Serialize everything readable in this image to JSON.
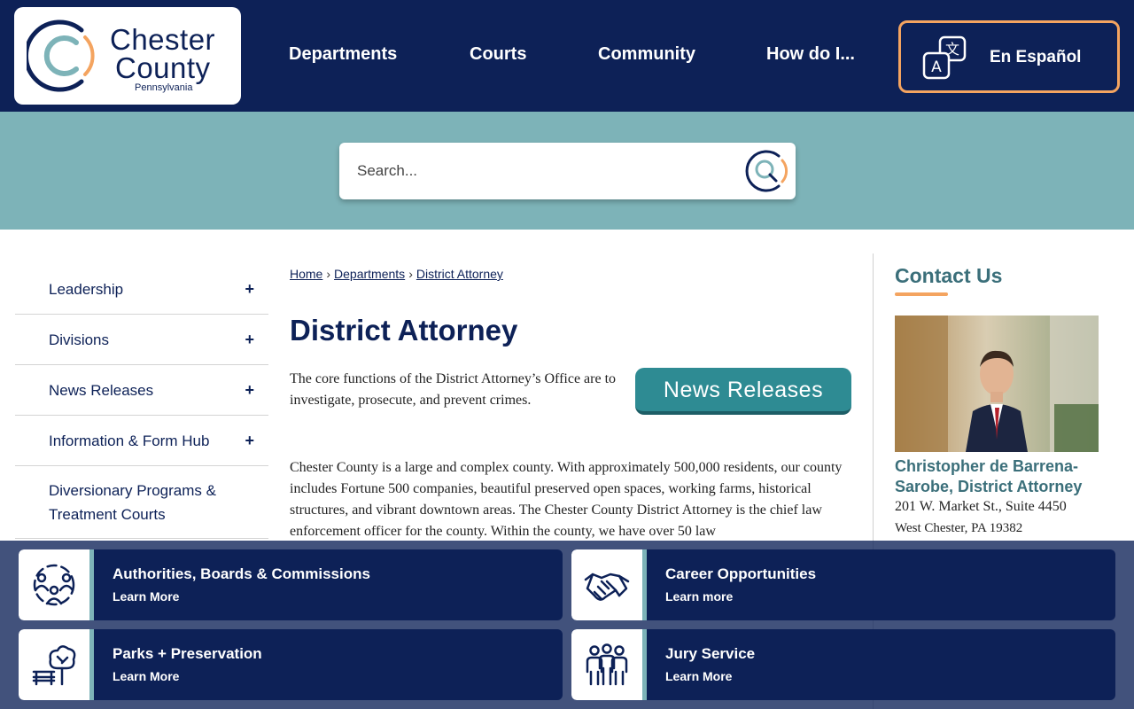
{
  "header": {
    "logo": {
      "line1": "Chester",
      "line2": "County",
      "line3": "Pennsylvania",
      "icon": "chester-county-logo-icon"
    },
    "nav": [
      {
        "label": "Departments"
      },
      {
        "label": "Courts"
      },
      {
        "label": "Community"
      },
      {
        "label": "How do I..."
      }
    ],
    "language_button": {
      "label": "En Español",
      "icon": "translate-icon"
    }
  },
  "search": {
    "placeholder": "Search...",
    "icon": "search-icon"
  },
  "sidebar": {
    "items": [
      {
        "label": "Leadership",
        "expand": "+"
      },
      {
        "label": "Divisions",
        "expand": "+"
      },
      {
        "label": "News Releases",
        "expand": "+"
      },
      {
        "label": "Information & Form Hub",
        "expand": "+"
      },
      {
        "label": "Diversionary Programs & Treatment Courts",
        "expand": ""
      }
    ]
  },
  "breadcrumb": {
    "items": [
      "Home",
      "Departments",
      "District Attorney"
    ],
    "separator": "›"
  },
  "main": {
    "title": "District Attorney",
    "intro": "The core functions of the District Attorney’s Office are to investigate, prosecute, and prevent crimes.",
    "news_button": "News Releases",
    "body": "Chester County is a large and complex county. With approximately 500,000 residents, our county includes Fortune 500 companies, beautiful preserved open spaces, working farms, historical structures, and vibrant downtown areas. The Chester County District Attorney is the chief law enforcement officer for the county. Within the county, we have over 50 law"
  },
  "contact": {
    "title": "Contact Us",
    "name": "Christopher de Barrena-Sarobe, District Attorney",
    "address1": "201 W. Market St., Suite 4450",
    "address2": "West Chester, PA 19382"
  },
  "quick_links": [
    {
      "title": "Authorities, Boards & Commissions",
      "more": "Learn More",
      "icon": "people-group-icon"
    },
    {
      "title": "Career Opportunities",
      "more": "Learn more",
      "icon": "handshake-icon"
    },
    {
      "title": "Parks + Preservation",
      "more": "Learn More",
      "icon": "park-bench-tree-icon"
    },
    {
      "title": "Jury Service",
      "more": "Learn More",
      "icon": "jury-people-icon"
    }
  ],
  "colors": {
    "navy": "#0d2157",
    "teal": "#7db3b8",
    "button_teal": "#2e8b93",
    "accent_orange": "#f4a460",
    "contact_teal": "#3b6f7a"
  }
}
